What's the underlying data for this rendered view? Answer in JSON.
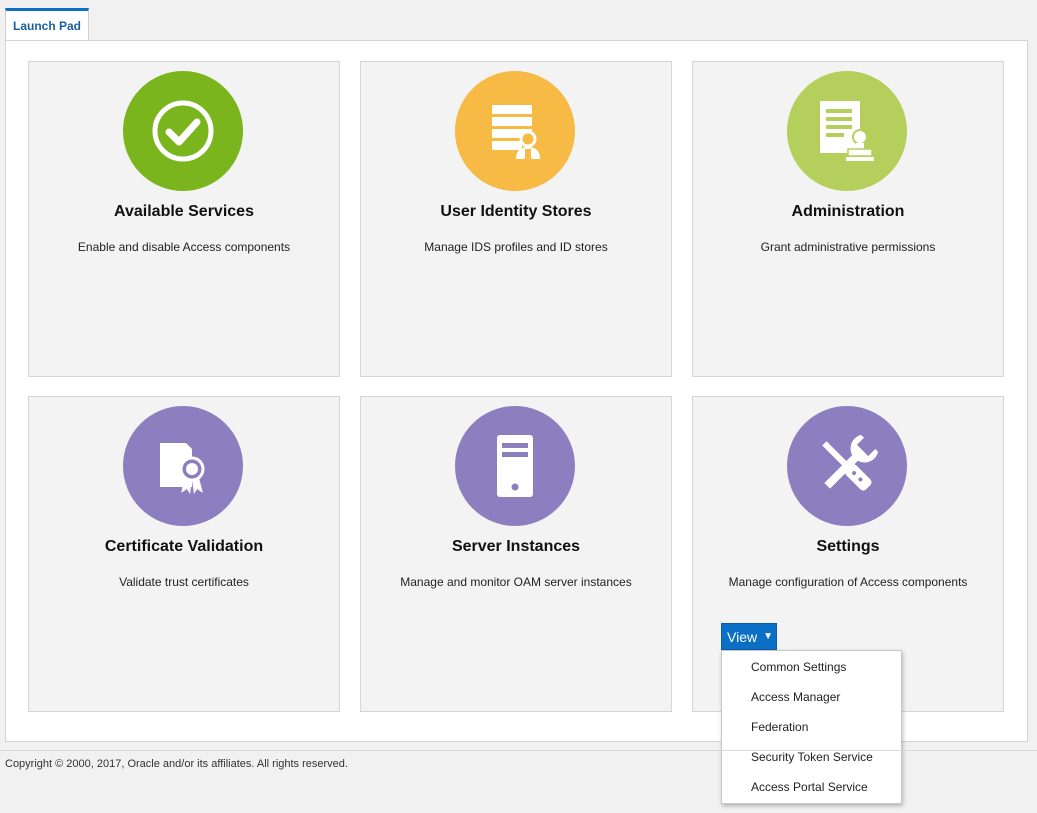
{
  "tab": {
    "label": "Launch Pad"
  },
  "colors": {
    "green": "#7ab51d",
    "orange": "#f6ba45",
    "lime": "#b4cf5b",
    "purple": "#8c7fc0",
    "accent": "#0c6fc6"
  },
  "cards": [
    {
      "title": "Available Services",
      "description": "Enable and disable Access components",
      "icon": "check-circle-icon"
    },
    {
      "title": "User Identity Stores",
      "description": "Manage IDS profiles and ID stores",
      "icon": "user-directory-icon"
    },
    {
      "title": "Administration",
      "description": "Grant administrative permissions",
      "icon": "document-stamp-icon"
    },
    {
      "title": "Certificate Validation",
      "description": "Validate trust certificates",
      "icon": "certificate-ribbon-icon"
    },
    {
      "title": "Server Instances",
      "description": "Manage and monitor OAM server instances",
      "icon": "server-icon"
    },
    {
      "title": "Settings",
      "description": "Manage configuration of Access components",
      "icon": "wrench-screwdriver-icon"
    }
  ],
  "view_menu": {
    "button_label": "View",
    "items": [
      "Common Settings",
      "Access Manager",
      "Federation",
      "Security Token Service",
      "Access Portal Service"
    ]
  },
  "footer": {
    "copyright": "Copyright © 2000, 2017, Oracle and/or its affiliates. All rights reserved."
  }
}
